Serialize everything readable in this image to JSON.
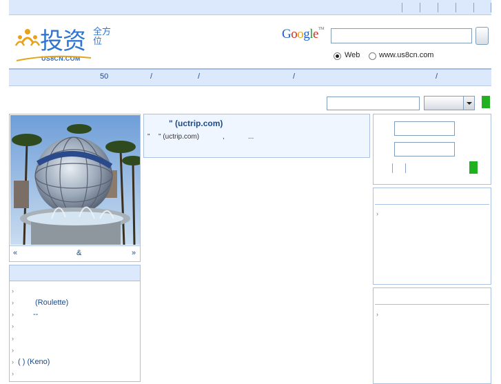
{
  "logo": {
    "main": "投资",
    "side": "全方位",
    "sub": "US8CN.COM"
  },
  "google": {
    "logo_parts": [
      {
        "t": "G",
        "c": "#1f5fd6"
      },
      {
        "t": "o",
        "c": "#d62d20"
      },
      {
        "t": "o",
        "c": "#e8a21a"
      },
      {
        "t": "g",
        "c": "#1f5fd6"
      },
      {
        "t": "l",
        "c": "#2e9a2e"
      },
      {
        "t": "e",
        "c": "#d62d20"
      }
    ],
    "trademark": "TM",
    "search_value": "",
    "radio_web": "Web",
    "radio_site": "www.us8cn.com",
    "selected": "Web"
  },
  "nav": {
    "items": [
      "50",
      "/",
      "/",
      "/",
      "/"
    ]
  },
  "site_search": {
    "value": "",
    "select_value": ""
  },
  "photo": {
    "caption_prev": "«",
    "caption_mid": "&",
    "caption_next": "»"
  },
  "list": {
    "items": [
      "",
      "(Roulette)",
      "--",
      "",
      "",
      "",
      "(  ) (Keno)",
      ""
    ]
  },
  "article": {
    "title": "\" (uctrip.com)",
    "body_quote": "\"",
    "body_source": "\" (uctrip.com)",
    "body_comma": ",",
    "body_more": "..."
  },
  "login": {
    "username_value": "",
    "password_value": ""
  },
  "colors": {
    "accent_blue": "#2f75d0",
    "nav_bg": "#dce8fb",
    "green_button": "#20b020"
  }
}
